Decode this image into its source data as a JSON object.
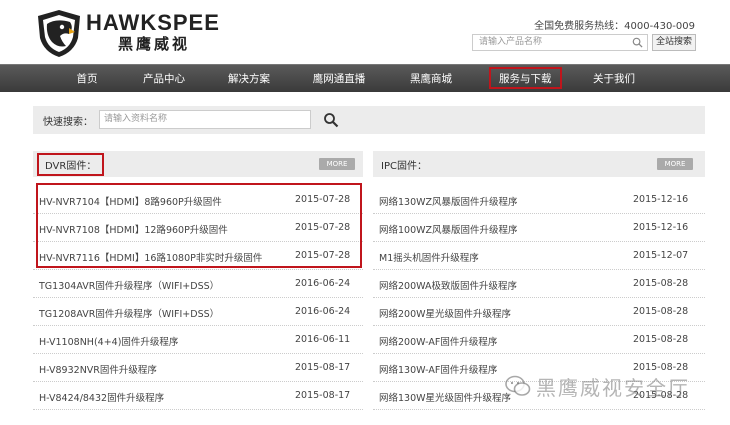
{
  "header": {
    "logo_text": "HAWKSPEE",
    "logo_cn": "黑鹰威视",
    "hotline": "全国免费服务热线：4000-430-009",
    "search_placeholder": "请输入产品名称",
    "site_search_label": "全站搜索"
  },
  "nav": {
    "items": [
      {
        "label": "首页"
      },
      {
        "label": "产品中心"
      },
      {
        "label": "解决方案"
      },
      {
        "label": "鹰网通直播"
      },
      {
        "label": "黑鹰商城"
      },
      {
        "label": "服务与下载"
      },
      {
        "label": "关于我们"
      }
    ]
  },
  "quick_search": {
    "label": "快速搜索：",
    "placeholder": "请输入资料名称"
  },
  "dvr": {
    "title": "DVR固件：",
    "more": "MORE",
    "rows": [
      {
        "name": "HV-NVR7104【HDMI】8路960P升级固件",
        "date": "2015-07-28"
      },
      {
        "name": "HV-NVR7108【HDMI】12路960P升级固件",
        "date": "2015-07-28"
      },
      {
        "name": "HV-NVR7116【HDMI】16路1080P非实时升级固件",
        "date": "2015-07-28"
      },
      {
        "name": "TG1304AVR固件升级程序（WIFI+DSS）",
        "date": "2016-06-24"
      },
      {
        "name": "TG1208AVR固件升级程序（WIFI+DSS）",
        "date": "2016-06-24"
      },
      {
        "name": "H-V1108NH(4+4)固件升级程序",
        "date": "2016-06-11"
      },
      {
        "name": "H-V8932NVR固件升级程序",
        "date": "2015-08-17"
      },
      {
        "name": "H-V8424/8432固件升级程序",
        "date": "2015-08-17"
      }
    ]
  },
  "ipc": {
    "title": "IPC固件：",
    "more": "MORE",
    "rows": [
      {
        "name": "网络130WZ风暴版固件升级程序",
        "date": "2015-12-16"
      },
      {
        "name": "网络100WZ风暴版固件升级程序",
        "date": "2015-12-16"
      },
      {
        "name": "M1摇头机固件升级程序",
        "date": "2015-12-07"
      },
      {
        "name": "网络200WA极致版固件升级程序",
        "date": "2015-08-28"
      },
      {
        "name": "网络200W星光级固件升级程序",
        "date": "2015-08-28"
      },
      {
        "name": "网络200W-AF固件升级程序",
        "date": "2015-08-28"
      },
      {
        "name": "网络130W-AF固件升级程序",
        "date": "2015-08-28"
      },
      {
        "name": "网络130W星光级固件升级程序",
        "date": "2015-08-28"
      }
    ]
  },
  "watermark": "黑鹰威视安全厅"
}
